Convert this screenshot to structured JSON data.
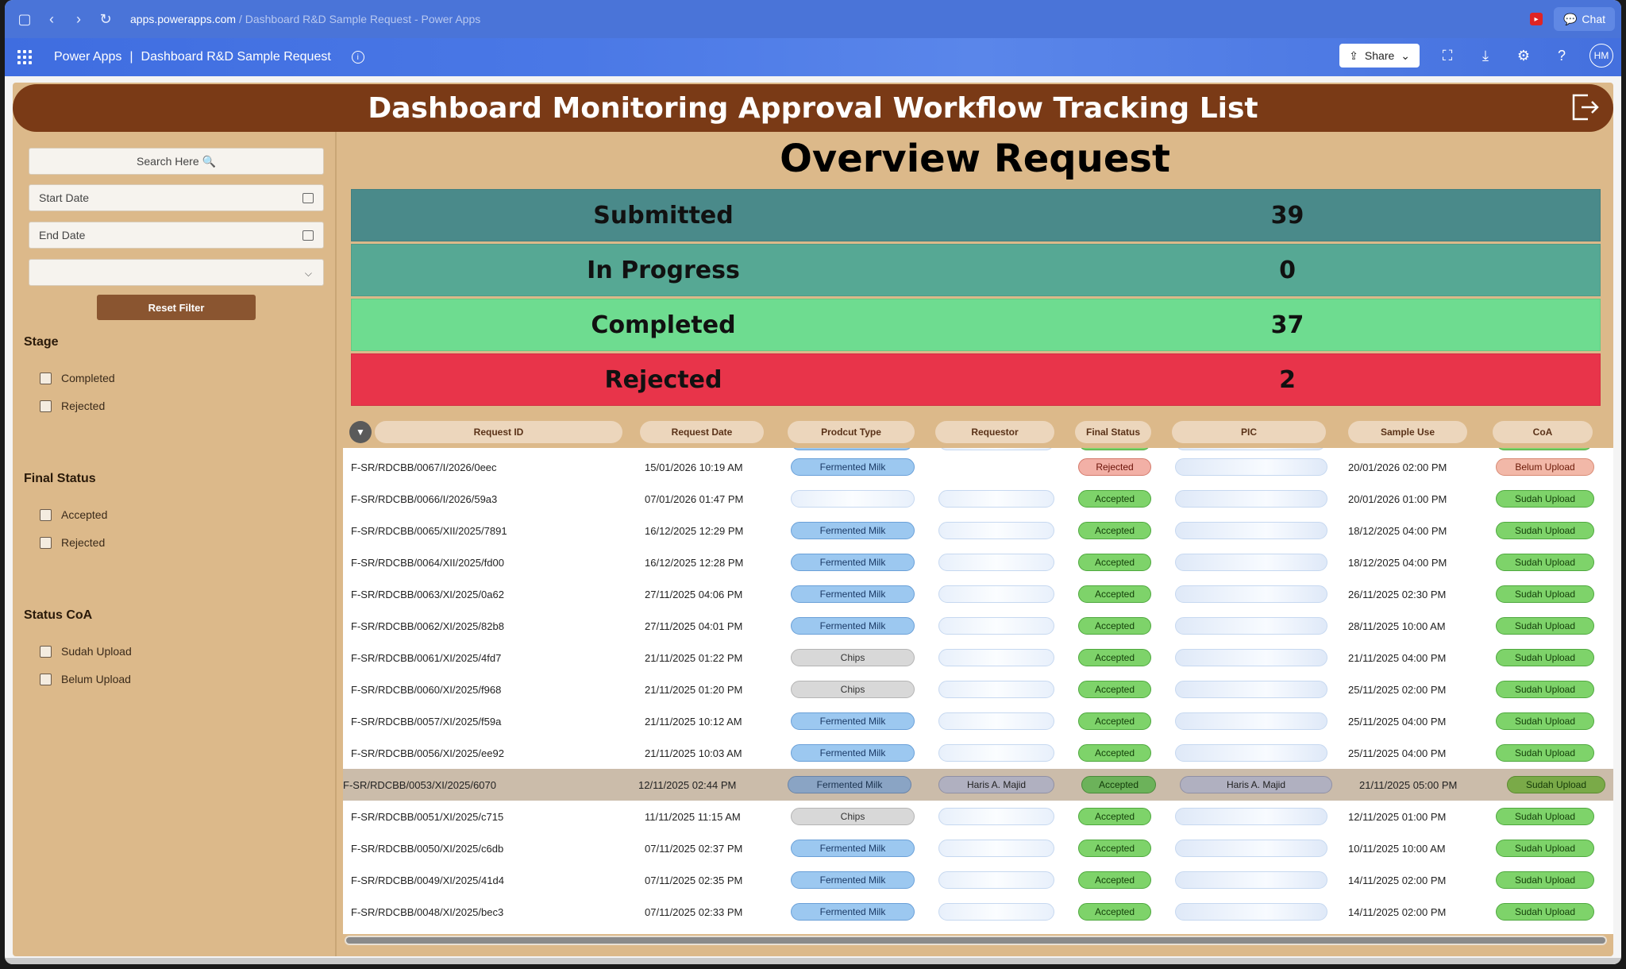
{
  "browser": {
    "url_host": "apps.powerapps.com",
    "url_rest": " / Dashboard R&D Sample Request - Power Apps",
    "chat_label": "Chat"
  },
  "app": {
    "name": "Power Apps",
    "separator": "|",
    "title": "Dashboard R&D Sample Request",
    "share_label": "Share",
    "avatar_initials": "HM"
  },
  "banner": {
    "title": "Dashboard Monitoring Approval Workflow Tracking List"
  },
  "filters": {
    "search_label": "Search Here 🔍",
    "start_date_placeholder": "Start Date",
    "end_date_placeholder": "End Date",
    "reset_label": "Reset Filter",
    "stage": {
      "heading": "Stage",
      "options": [
        "Completed",
        "Rejected"
      ]
    },
    "final_status": {
      "heading": "Final Status",
      "options": [
        "Accepted",
        "Rejected"
      ]
    },
    "status_coa": {
      "heading": "Status CoA",
      "options": [
        "Sudah Upload",
        "Belum Upload"
      ]
    }
  },
  "overview": {
    "title": "Overview Request",
    "stats": [
      {
        "label": "Submitted",
        "value": "39",
        "color": "#4a8a8a"
      },
      {
        "label": "In Progress",
        "value": "0",
        "color": "#56a894"
      },
      {
        "label": "Completed",
        "value": "37",
        "color": "#6edc90"
      },
      {
        "label": "Rejected",
        "value": "2",
        "color": "#e8344a"
      }
    ]
  },
  "table": {
    "columns": [
      "Request ID",
      "Request Date",
      "Prodcut Type",
      "Requestor",
      "Final Status",
      "PIC",
      "Sample Use",
      "CoA"
    ],
    "rows": [
      {
        "id": "F-SR/RDCBB/0067/I/2026/0eec",
        "date": "15/01/2026 10:19 AM",
        "product": "Fermented Milk",
        "requestor": "",
        "status": "Rejected",
        "pic": "",
        "use": "20/01/2026 02:00 PM",
        "coa": "Belum Upload"
      },
      {
        "id": "F-SR/RDCBB/0066/I/2026/59a3",
        "date": "07/01/2026 01:47 PM",
        "product": "",
        "requestor": "",
        "status": "Accepted",
        "pic": "",
        "use": "20/01/2026 01:00 PM",
        "coa": "Sudah Upload"
      },
      {
        "id": "F-SR/RDCBB/0065/XII/2025/7891",
        "date": "16/12/2025 12:29 PM",
        "product": "Fermented Milk",
        "requestor": "",
        "status": "Accepted",
        "pic": "",
        "use": "18/12/2025 04:00 PM",
        "coa": "Sudah Upload"
      },
      {
        "id": "F-SR/RDCBB/0064/XII/2025/fd00",
        "date": "16/12/2025 12:28 PM",
        "product": "Fermented Milk",
        "requestor": "",
        "status": "Accepted",
        "pic": "",
        "use": "18/12/2025 04:00 PM",
        "coa": "Sudah Upload"
      },
      {
        "id": "F-SR/RDCBB/0063/XI/2025/0a62",
        "date": "27/11/2025 04:06 PM",
        "product": "Fermented Milk",
        "requestor": "",
        "status": "Accepted",
        "pic": "",
        "use": "26/11/2025 02:30 PM",
        "coa": "Sudah Upload"
      },
      {
        "id": "F-SR/RDCBB/0062/XI/2025/82b8",
        "date": "27/11/2025 04:01 PM",
        "product": "Fermented Milk",
        "requestor": "",
        "status": "Accepted",
        "pic": "",
        "use": "28/11/2025 10:00 AM",
        "coa": "Sudah Upload"
      },
      {
        "id": "F-SR/RDCBB/0061/XI/2025/4fd7",
        "date": "21/11/2025 01:22 PM",
        "product": "Chips",
        "requestor": "",
        "status": "Accepted",
        "pic": "",
        "use": "21/11/2025 04:00 PM",
        "coa": "Sudah Upload"
      },
      {
        "id": "F-SR/RDCBB/0060/XI/2025/f968",
        "date": "21/11/2025 01:20 PM",
        "product": "Chips",
        "requestor": "",
        "status": "Accepted",
        "pic": "",
        "use": "25/11/2025 02:00 PM",
        "coa": "Sudah Upload"
      },
      {
        "id": "F-SR/RDCBB/0057/XI/2025/f59a",
        "date": "21/11/2025 10:12 AM",
        "product": "Fermented Milk",
        "requestor": "",
        "status": "Accepted",
        "pic": "",
        "use": "25/11/2025 04:00 PM",
        "coa": "Sudah Upload"
      },
      {
        "id": "F-SR/RDCBB/0056/XI/2025/ee92",
        "date": "21/11/2025 10:03 AM",
        "product": "Fermented Milk",
        "requestor": "",
        "status": "Accepted",
        "pic": "",
        "use": "25/11/2025 04:00 PM",
        "coa": "Sudah Upload"
      },
      {
        "id": "F-SR/RDCBB/0053/XI/2025/6070",
        "date": "12/11/2025 02:44 PM",
        "product": "Fermented Milk",
        "requestor": "Haris A. Majid",
        "status": "Accepted",
        "pic": "Haris A. Majid",
        "use": "21/11/2025 05:00 PM",
        "coa": "Sudah Upload",
        "selected": true
      },
      {
        "id": "F-SR/RDCBB/0051/XI/2025/c715",
        "date": "11/11/2025 11:15 AM",
        "product": "Chips",
        "requestor": "",
        "status": "Accepted",
        "pic": "",
        "use": "12/11/2025 01:00 PM",
        "coa": "Sudah Upload"
      },
      {
        "id": "F-SR/RDCBB/0050/XI/2025/c6db",
        "date": "07/11/2025 02:37 PM",
        "product": "Fermented Milk",
        "requestor": "",
        "status": "Accepted",
        "pic": "",
        "use": "10/11/2025 10:00 AM",
        "coa": "Sudah Upload"
      },
      {
        "id": "F-SR/RDCBB/0049/XI/2025/41d4",
        "date": "07/11/2025 02:35 PM",
        "product": "Fermented Milk",
        "requestor": "",
        "status": "Accepted",
        "pic": "",
        "use": "14/11/2025 02:00 PM",
        "coa": "Sudah Upload"
      },
      {
        "id": "F-SR/RDCBB/0048/XI/2025/bec3",
        "date": "07/11/2025 02:33 PM",
        "product": "Fermented Milk",
        "requestor": "",
        "status": "Accepted",
        "pic": "",
        "use": "14/11/2025 02:00 PM",
        "coa": "Sudah Upload"
      }
    ]
  }
}
